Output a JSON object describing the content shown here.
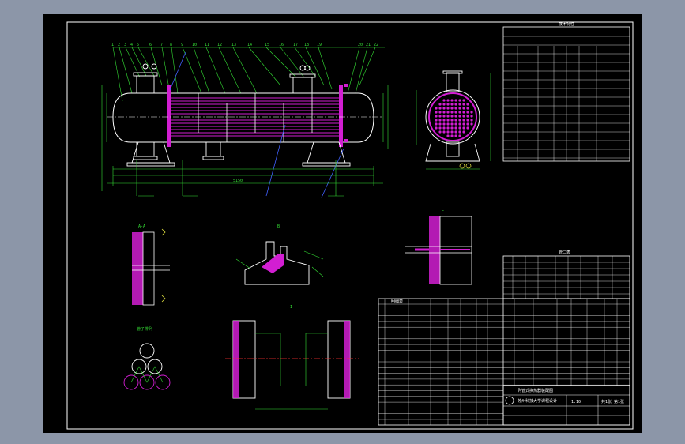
{
  "drawing": {
    "tech_table_title": "技术特性",
    "bom_title": "明细表",
    "nozzle_table_title": "管口表",
    "company": "苏州科技大学课程设计",
    "drawing_title": "列管式换热器装配图",
    "scale": "1:10",
    "sheet": "共1张 第1张",
    "view_label_a": "A-A",
    "view_label_b": "B",
    "view_label_c": "C",
    "view_label_d": "I",
    "view_label_e": "管子排列",
    "dim_total": "5150"
  },
  "colors": {
    "background": "#000000",
    "outer": "#8c96a8",
    "line": "#ffffff",
    "dim": "#35e035",
    "hatch": "#d21ed2",
    "leader": "#4060ff",
    "yellow": "#e0e040"
  }
}
